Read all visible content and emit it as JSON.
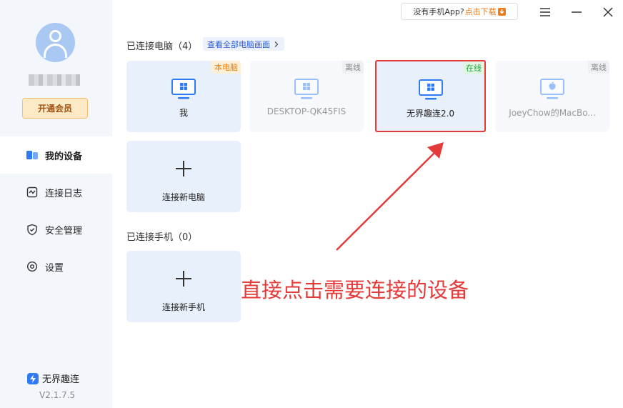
{
  "sidebar": {
    "vip_button": "开通会员",
    "nav": [
      {
        "label": "我的设备",
        "icon": "devices-icon"
      },
      {
        "label": "连接日志",
        "icon": "log-icon"
      },
      {
        "label": "安全管理",
        "icon": "shield-icon"
      },
      {
        "label": "设置",
        "icon": "gear-icon"
      }
    ],
    "brand": "无界趣连",
    "version": "V2.1.7.5"
  },
  "topbar": {
    "download_prompt": "没有手机App?",
    "download_link": "点击下载"
  },
  "computers": {
    "title": "已连接电脑（4）",
    "view_all": "查看全部电脑画面",
    "devices": [
      {
        "name": "我",
        "tag": "本电脑",
        "status": "mine"
      },
      {
        "name": "DESKTOP-QK45FIS",
        "tag": "离线",
        "status": "offline"
      },
      {
        "name": "无界趣连2.0",
        "tag": "在线",
        "status": "online"
      },
      {
        "name": "JoeyChow的MacBo...",
        "tag": "离线",
        "status": "offline"
      }
    ],
    "add_label": "连接新电脑"
  },
  "phones": {
    "title": "已连接手机（0）",
    "add_label": "连接新手机"
  },
  "annotation": "直接点击需要连接的设备",
  "colors": {
    "accent": "#2f7bf5",
    "annotation": "#e53a3a",
    "online": "#21a33a",
    "mine": "#e8800c"
  }
}
